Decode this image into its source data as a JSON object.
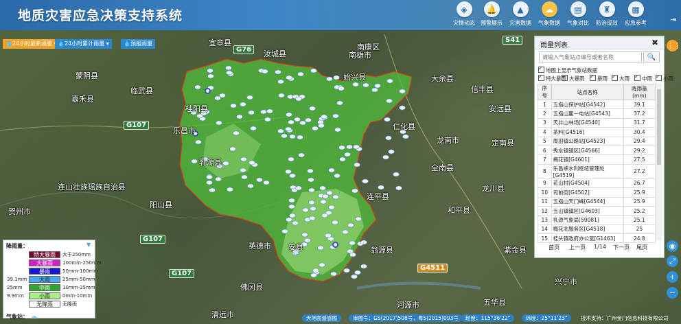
{
  "app": {
    "title": "地质灾害应急决策支持系统"
  },
  "nav": [
    {
      "label": "灾情动态",
      "icon": "tag-icon",
      "glyph": "◈"
    },
    {
      "label": "预警展示",
      "icon": "bell-icon",
      "glyph": "🔔"
    },
    {
      "label": "灾害数据",
      "icon": "warning-icon",
      "glyph": "▲"
    },
    {
      "label": "气象数据",
      "icon": "cloud-icon",
      "glyph": "☁"
    },
    {
      "label": "气象对比",
      "icon": "document-icon",
      "glyph": "▤"
    },
    {
      "label": "防治成效",
      "icon": "hydrant-icon",
      "glyph": "♜"
    },
    {
      "label": "应急参考",
      "icon": "map-book-icon",
      "glyph": "▦"
    }
  ],
  "toolbar": {
    "btn1": "24小时最新雨量",
    "btn2": "24小时累计雨量",
    "btn3": "预报雨量"
  },
  "map_labels": {
    "places": [
      "蒙阴县",
      "汝城县",
      "临武县",
      "嘉禾县",
      "宜章县",
      "桂阳县",
      "连山壮族瑶族自治县",
      "阳山县",
      "贺州市",
      "英德市",
      "佛冈县",
      "清远市",
      "始兴县",
      "南雄市",
      "大余县",
      "信丰县",
      "龙南市",
      "全南县",
      "和平县",
      "龙川县",
      "连平县",
      "河源市",
      "五华县",
      "安远县",
      "定南县",
      "兴宁市",
      "乐昌市",
      "翁源县",
      "南康区",
      "乳源县",
      "仁化县",
      "安县",
      "紫金县",
      "连平"
    ],
    "roads": [
      "G76",
      "S41",
      "G107",
      "G107",
      "G4511",
      "G107"
    ]
  },
  "rain_panel": {
    "title": "雨量列表",
    "search_placeholder": "请输入气象站点编号或者名称",
    "show_on_map": "地图上显示气象站数据",
    "filters": [
      "特大暴雨",
      "大暴雨",
      "暴雨",
      "大雨",
      "中雨",
      "小雨"
    ],
    "columns": [
      "序号",
      "站点名称",
      "降雨量(mm)"
    ],
    "rows": [
      [
        "1",
        "五指山保护站[G4542]",
        "39.1"
      ],
      [
        "2",
        "五指山鳌一电站[G4543]",
        "37.2"
      ],
      [
        "3",
        "天井山林场[G4540]",
        "31.7"
      ],
      [
        "4",
        "茶料[G4516]",
        "30.4"
      ],
      [
        "5",
        "周田镇公路站[G4523]",
        "29.4"
      ],
      [
        "6",
        "秀水镇镇区[G4566]",
        "29.2"
      ],
      [
        "7",
        "梅花镇[G4601]",
        "27.5"
      ],
      [
        "8",
        "乐昌峡水利枢纽管理处[G4519]",
        "27.2"
      ],
      [
        "9",
        "花山村[G4504]",
        "26.7"
      ],
      [
        "10",
        "司前街[G4502]",
        "25.9"
      ],
      [
        "11",
        "五指山天门峰[G4544]",
        "25.9"
      ],
      [
        "12",
        "五山镇镇区[G4603]",
        "25.2"
      ],
      [
        "13",
        "乳源气象局[59081]",
        "25.1"
      ],
      [
        "14",
        "梅花北服务区[G4518]",
        "25"
      ],
      [
        "15",
        "桂头镇政府办公室[G1463]",
        "24.8"
      ]
    ],
    "pager": {
      "first": "首页",
      "prev": "上一页",
      "page": "1/14",
      "next": "下一页",
      "last": "尾页"
    }
  },
  "legend": {
    "title": "降雨量：",
    "items": [
      {
        "label": "特大暴雨",
        "range": "大于250mm",
        "left": "",
        "color": "#7a0a2e",
        "text": "#ffffff"
      },
      {
        "label": "大暴雨",
        "range": "100mm-250mm",
        "left": "",
        "color": "#d21fc7",
        "text": "#ffffff"
      },
      {
        "label": "暴雨",
        "range": "50mm-100mm",
        "left": "",
        "color": "#1a1ad4",
        "text": "#ffffff"
      },
      {
        "label": "大雨",
        "range": "25mm-50mm",
        "left": "39.1mm",
        "color": "#4aa8f0",
        "text": "#222222"
      },
      {
        "label": "中雨",
        "range": "10mm-25mm",
        "left": "25mm",
        "color": "#2fa82f",
        "text": "#ffffff"
      },
      {
        "label": "小雨",
        "range": "0mm-10mm",
        "left": "9.9mm",
        "color": "#a8f08a",
        "text": "#222222"
      },
      {
        "label": "无降雨",
        "range": "无降雨",
        "left": "",
        "color": "#ffffff",
        "text": "#222222"
      }
    ],
    "station_label": "气象站："
  },
  "statusbar": {
    "basemap": "天地图遥感图",
    "approval": "审图号：GS(2017)508号，粤S(2015)093号",
    "longitude": "经度：115°36'22\"",
    "latitude": "纬度：25°11'23\"",
    "support": "技术支持：广州金门信息科技有限公司"
  },
  "colors": {
    "region_fill": "#4fbd3a",
    "region_light": "#8fd86a",
    "region_border": "#d83a1a",
    "header": "#3d86c6"
  }
}
